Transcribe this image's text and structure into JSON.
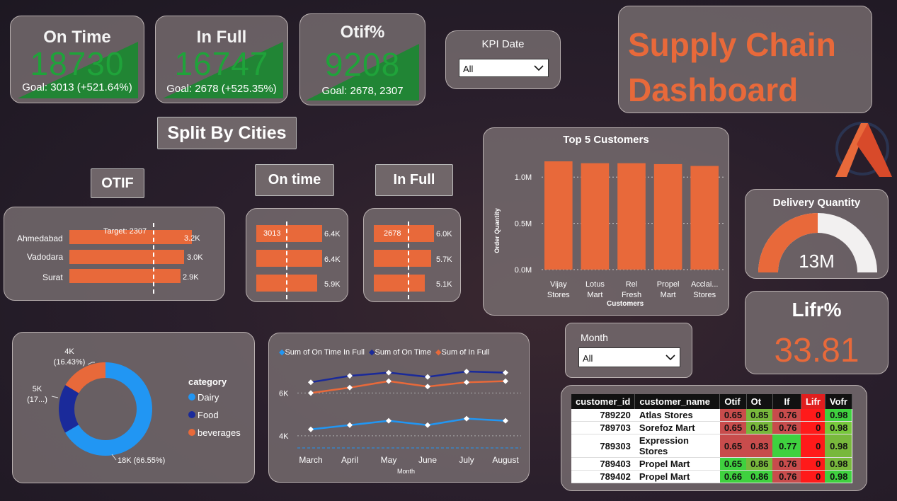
{
  "kpis": {
    "on_time": {
      "title": "On Time",
      "value": "18730",
      "goal": "Goal: 3013 (+521.64%)"
    },
    "in_full": {
      "title": "In Full",
      "value": "16747",
      "goal": "Goal: 2678 (+525.35%)"
    },
    "otif": {
      "title": "Otif%",
      "value": "9208",
      "goal": "Goal: 2678, 2307"
    }
  },
  "kpi_date": {
    "label": "KPI Date",
    "selected": "All"
  },
  "header": {
    "title_line1": "Supply Chain",
    "title_line2": "Dashboard"
  },
  "split_label": "Split By Cities",
  "city_otif": {
    "label": "OTIF",
    "target_label": "Target: 2307",
    "rows": [
      {
        "city": "Ahmedabad",
        "value": 3.2,
        "label": "3.2K"
      },
      {
        "city": "Vadodara",
        "value": 3.0,
        "label": "3.0K"
      },
      {
        "city": "Surat",
        "value": 2.9,
        "label": "2.9K"
      }
    ]
  },
  "city_ontime": {
    "label": "On time",
    "target_label": "3013",
    "rows": [
      {
        "value": 6.4,
        "label": "6.4K"
      },
      {
        "value": 6.4,
        "label": "6.4K"
      },
      {
        "value": 5.9,
        "label": "5.9K"
      }
    ]
  },
  "city_infull": {
    "label": "In Full",
    "target_label": "2678",
    "rows": [
      {
        "value": 6.0,
        "label": "6.0K"
      },
      {
        "value": 5.7,
        "label": "5.7K"
      },
      {
        "value": 5.1,
        "label": "5.1K"
      }
    ]
  },
  "chart_data": [
    {
      "type": "bar",
      "title": "Top 5 Customers",
      "xlabel": "Customers",
      "ylabel": "Order Quantity",
      "categories": [
        "Vijay Stores",
        "Lotus Mart",
        "Rel Fresh",
        "Propel Mart",
        "Acclai... Stores"
      ],
      "category_lines": [
        [
          "Vijay",
          "Stores"
        ],
        [
          "Lotus",
          "Mart"
        ],
        [
          "Rel",
          "Fresh"
        ],
        [
          "Propel",
          "Mart"
        ],
        [
          "Acclai...",
          "Stores"
        ]
      ],
      "values": [
        1.17,
        1.15,
        1.15,
        1.14,
        1.12
      ],
      "ylim": [
        0,
        1.3
      ],
      "ytick_values": [
        0,
        0.5,
        1.0
      ],
      "ytick_labels": [
        "0.0M",
        "0.5M",
        "1.0M"
      ]
    },
    {
      "type": "pie",
      "legend_title": "category",
      "slices": [
        {
          "name": "Dairy",
          "value": 66.55,
          "label": "18K (66.55%)",
          "color": "#2196f3"
        },
        {
          "name": "Food",
          "value": 16.99,
          "label": "5K (17...)",
          "color": "#1a2a9a"
        },
        {
          "name": "beverages",
          "value": 16.43,
          "label": "4K (16.43%)",
          "color": "#e8693a"
        }
      ]
    },
    {
      "type": "line",
      "xlabel": "Month",
      "categories": [
        "March",
        "April",
        "May",
        "June",
        "July",
        "August"
      ],
      "ylim": [
        3.5,
        7.2
      ],
      "ytick_values": [
        4,
        6
      ],
      "ytick_labels": [
        "4K",
        "6K"
      ],
      "series": [
        {
          "name": "Sum of On Time In Full",
          "color": "#2196f3",
          "values": [
            4.3,
            4.5,
            4.7,
            4.5,
            4.8,
            4.7
          ]
        },
        {
          "name": "Sum of On Time",
          "color": "#1a2a9a",
          "values": [
            6.5,
            6.8,
            6.95,
            6.75,
            7.0,
            6.95
          ]
        },
        {
          "name": "Sum of In Full",
          "color": "#e8693a",
          "values": [
            6.0,
            6.25,
            6.55,
            6.3,
            6.5,
            6.55
          ]
        }
      ]
    }
  ],
  "delivery": {
    "title": "Delivery Quantity",
    "value": "13M",
    "fraction": 0.5
  },
  "lifr": {
    "title": "Lifr%",
    "value": "33.81"
  },
  "month_filter": {
    "label": "Month",
    "selected": "All"
  },
  "table": {
    "headers": [
      "customer_id",
      "customer_name",
      "Otif",
      "Ot",
      "If",
      "Lifr",
      "Vofr"
    ],
    "rows": [
      [
        "789220",
        "Atlas Stores",
        "0.65",
        "0.85",
        "0.76",
        "0",
        "0.98"
      ],
      [
        "789703",
        "Sorefoz Mart",
        "0.65",
        "0.85",
        "0.76",
        "0",
        "0.98"
      ],
      [
        "789303",
        "Expression Stores",
        "0.65",
        "0.83",
        "0.77",
        "0",
        "0.98"
      ],
      [
        "789403",
        "Propel Mart",
        "0.65",
        "0.86",
        "0.76",
        "0",
        "0.98"
      ],
      [
        "789402",
        "Propel Mart",
        "0.66",
        "0.86",
        "0.76",
        "0",
        "0.98"
      ]
    ],
    "cell_colors": [
      [
        "#c84c4c",
        "#78b83c",
        "#c84c4c",
        "#ff1a1a",
        "#3fd13f"
      ],
      [
        "#c84c4c",
        "#78b83c",
        "#c84c4c",
        "#ff1a1a",
        "#78c83c"
      ],
      [
        "#c84c4c",
        "#c84c4c",
        "#3fd13f",
        "#ff1a1a",
        "#78b83c"
      ],
      [
        "#3fd13f",
        "#78b83c",
        "#c84c4c",
        "#ff1a1a",
        "#78b83c"
      ],
      [
        "#3fd13f",
        "#3fd13f",
        "#c84c4c",
        "#ff1a1a",
        "#3fd13f"
      ]
    ],
    "lifr_header_color": "#e01e1e"
  },
  "colors": {
    "accent": "#e8693a",
    "kpi_green": "#1fa33a"
  }
}
